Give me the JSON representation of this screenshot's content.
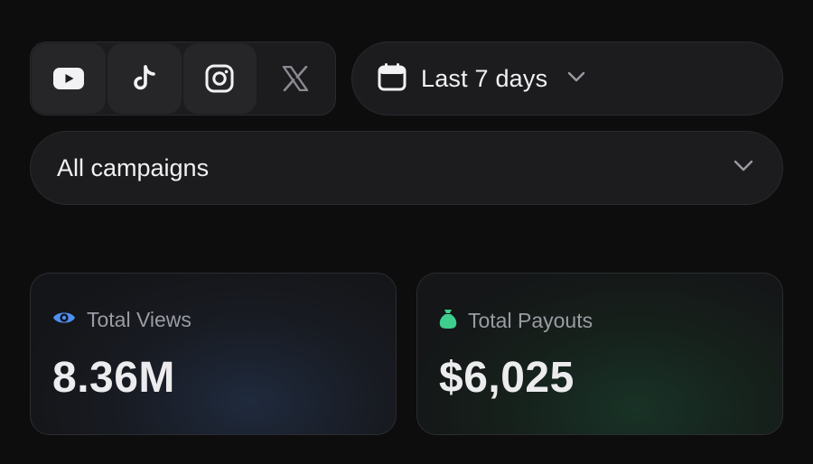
{
  "platforms": [
    {
      "name": "YouTube",
      "icon": "youtube-icon",
      "active": true
    },
    {
      "name": "TikTok",
      "icon": "tiktok-icon",
      "active": true
    },
    {
      "name": "Instagram",
      "icon": "instagram-icon",
      "active": true
    },
    {
      "name": "X",
      "icon": "x-icon",
      "active": false
    }
  ],
  "date_range": {
    "label": "Last 7 days",
    "icon": "calendar-icon"
  },
  "campaign_filter": {
    "label": "All campaigns"
  },
  "stats": {
    "views": {
      "title": "Total Views",
      "value": "8.36M",
      "icon": "eye-icon",
      "accent": "#4f8ff0"
    },
    "payouts": {
      "title": "Total Payouts",
      "value": "$6,025",
      "icon": "money-bag-icon",
      "accent": "#3ecf8e"
    }
  }
}
